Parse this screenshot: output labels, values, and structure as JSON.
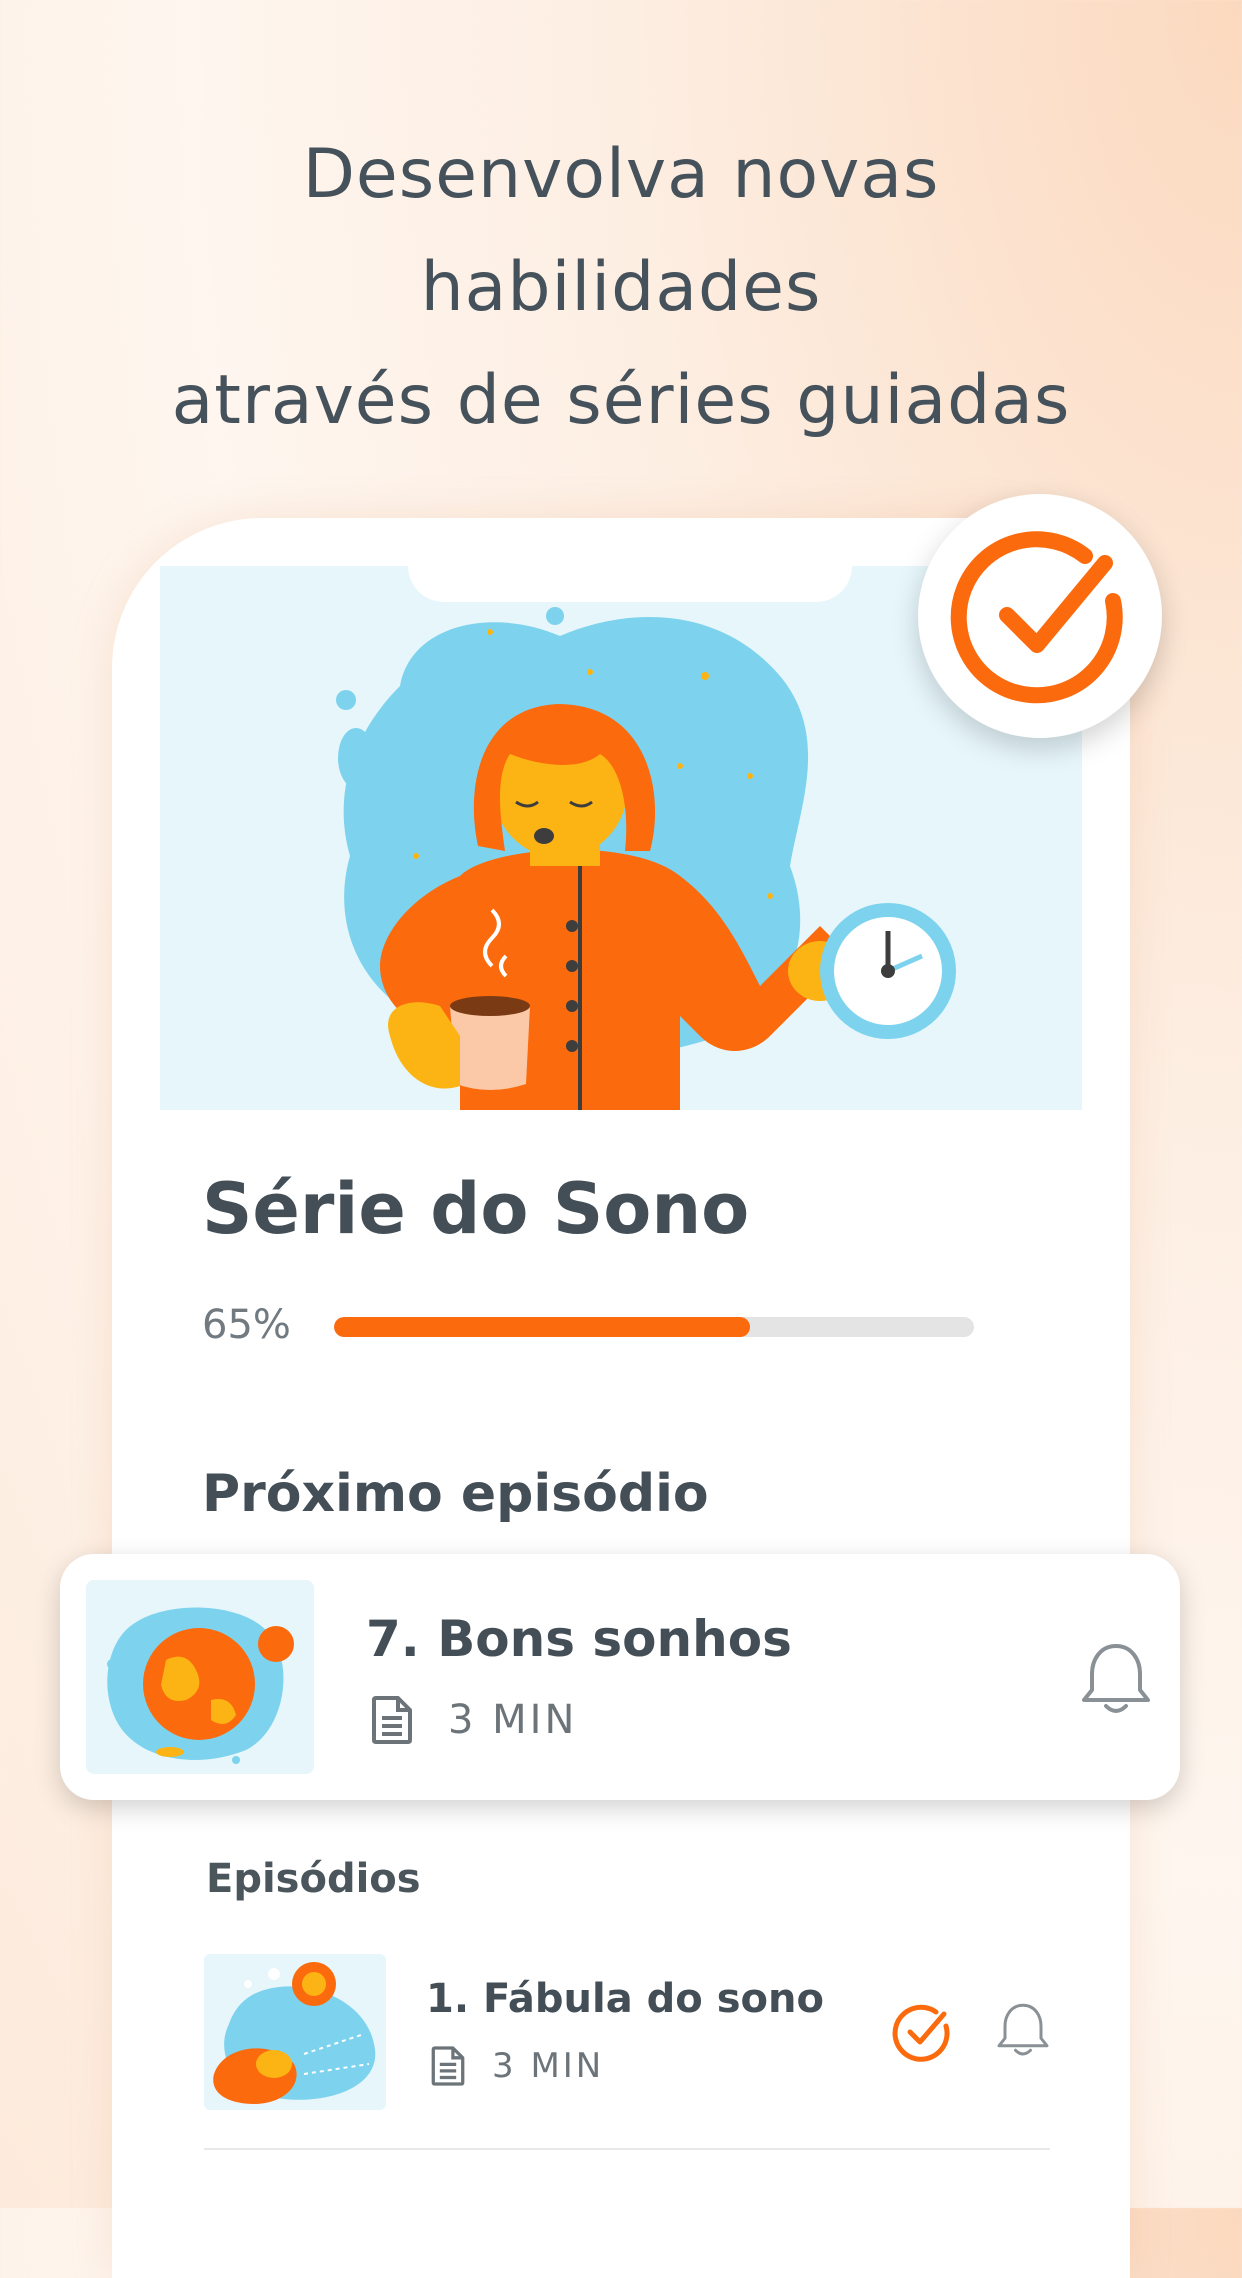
{
  "headline": {
    "line1": "Desenvolva novas",
    "line2": "habilidades",
    "line3": "através de séries guiadas"
  },
  "series": {
    "title": "Série do Sono",
    "progress_label": "65%",
    "progress_value": 0.65
  },
  "next_episode": {
    "section_label": "Próximo episódio",
    "title": "7. Bons sonhos",
    "duration": "3 MIN"
  },
  "episodes": {
    "section_label": "Episódios",
    "items": [
      {
        "title": "1. Fábula do sono",
        "duration": "3 MIN",
        "completed": true
      }
    ]
  },
  "colors": {
    "accent": "#fb6a0c",
    "text_dark": "#434e56",
    "sky_blue": "#7dd3ee",
    "pale_blue": "#e6f6fb",
    "skin": "#fcb414"
  },
  "icons": {
    "badge": "check-circle-icon",
    "duration": "document-icon",
    "reminder": "bell-icon",
    "completed": "check-circle-icon"
  }
}
